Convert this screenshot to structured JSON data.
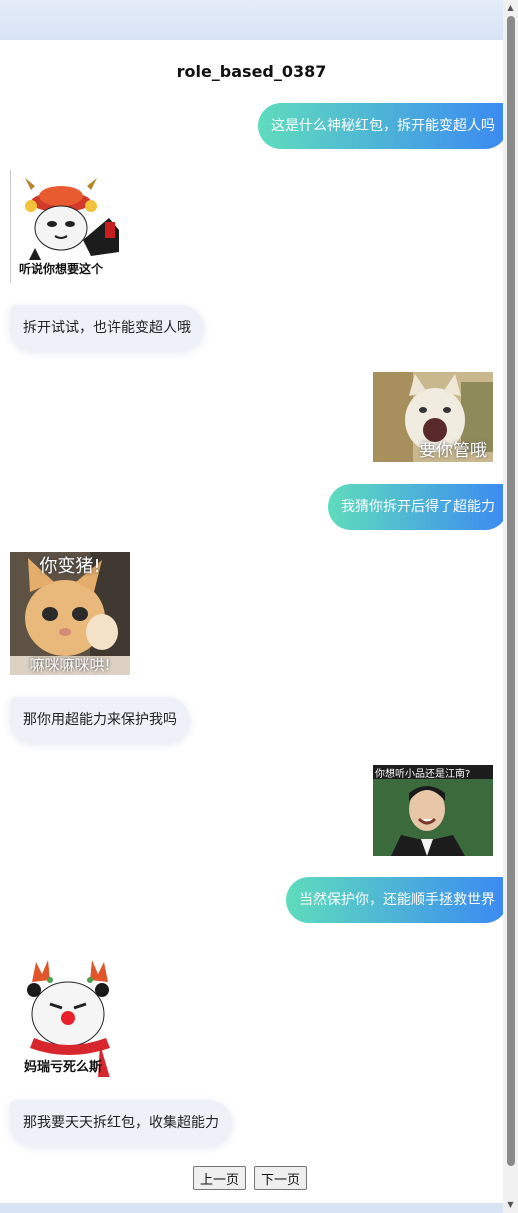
{
  "chat": {
    "title": "role_based_0387",
    "messages": [
      {
        "text": "这是什么神秘红包，拆开能变超人吗"
      },
      {
        "sticker_caption": "听说你想要这个"
      },
      {
        "text": "拆开试试，也许能变超人哦"
      },
      {
        "sticker_caption": "要你管哦"
      },
      {
        "text": "我猜你拆开后得了超能力"
      },
      {
        "sticker_caption_top": "你变猪!",
        "sticker_caption_bottom": "嘛咪嘛咪哄!"
      },
      {
        "text": "那你用超能力来保护我吗"
      },
      {
        "sticker_caption": "你想听小品还是江南?"
      },
      {
        "text": "当然保护你，还能顺手拯救世界"
      },
      {
        "sticker_caption": "妈瑞亏死么斯"
      },
      {
        "text": "那我要天天拆红包，收集超能力"
      }
    ]
  },
  "pagination": {
    "prev_label": "上一页",
    "next_label": "下一页"
  },
  "icons": {
    "scroll_up": "scroll-up-arrow-icon",
    "scroll_down": "scroll-down-arrow-icon"
  },
  "colors": {
    "bubble_gradient_start": "#5fdcbd",
    "bubble_gradient_end": "#3b89f2",
    "left_bubble_bg": "#eef2f8"
  }
}
